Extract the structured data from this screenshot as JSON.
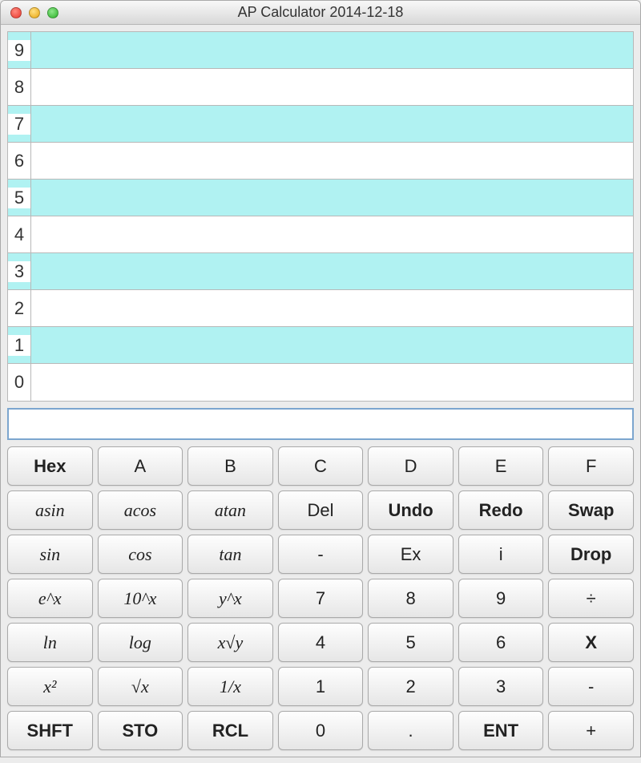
{
  "window": {
    "title": "AP Calculator 2014-12-18"
  },
  "stack": {
    "rows": [
      {
        "index": "9",
        "value": "",
        "alt": true
      },
      {
        "index": "8",
        "value": "",
        "alt": false
      },
      {
        "index": "7",
        "value": "",
        "alt": true
      },
      {
        "index": "6",
        "value": "",
        "alt": false
      },
      {
        "index": "5",
        "value": "",
        "alt": true
      },
      {
        "index": "4",
        "value": "",
        "alt": false
      },
      {
        "index": "3",
        "value": "",
        "alt": true
      },
      {
        "index": "2",
        "value": "",
        "alt": false
      },
      {
        "index": "1",
        "value": "",
        "alt": true
      },
      {
        "index": "0",
        "value": "",
        "alt": false
      }
    ]
  },
  "input": {
    "value": ""
  },
  "keypad": {
    "rows": [
      [
        {
          "label": "Hex",
          "style": "bold",
          "name": "hex-button"
        },
        {
          "label": "A",
          "style": "",
          "name": "hex-a-button"
        },
        {
          "label": "B",
          "style": "",
          "name": "hex-b-button"
        },
        {
          "label": "C",
          "style": "",
          "name": "hex-c-button"
        },
        {
          "label": "D",
          "style": "",
          "name": "hex-d-button"
        },
        {
          "label": "E",
          "style": "",
          "name": "hex-e-button"
        },
        {
          "label": "F",
          "style": "",
          "name": "hex-f-button"
        }
      ],
      [
        {
          "label": "asin",
          "style": "italic",
          "name": "asin-button"
        },
        {
          "label": "acos",
          "style": "italic",
          "name": "acos-button"
        },
        {
          "label": "atan",
          "style": "italic",
          "name": "atan-button"
        },
        {
          "label": "Del",
          "style": "",
          "name": "del-button"
        },
        {
          "label": "Undo",
          "style": "bold",
          "name": "undo-button"
        },
        {
          "label": "Redo",
          "style": "bold",
          "name": "redo-button"
        },
        {
          "label": "Swap",
          "style": "bold",
          "name": "swap-button"
        }
      ],
      [
        {
          "label": "sin",
          "style": "italic",
          "name": "sin-button"
        },
        {
          "label": "cos",
          "style": "italic",
          "name": "cos-button"
        },
        {
          "label": "tan",
          "style": "italic",
          "name": "tan-button"
        },
        {
          "label": "-",
          "style": "",
          "name": "negate-button"
        },
        {
          "label": "Ex",
          "style": "",
          "name": "ex-button"
        },
        {
          "label": "i",
          "style": "",
          "name": "imaginary-button"
        },
        {
          "label": "Drop",
          "style": "bold",
          "name": "drop-button"
        }
      ],
      [
        {
          "label": "e^x",
          "style": "italic",
          "name": "exp-button"
        },
        {
          "label": "10^x",
          "style": "italic",
          "name": "ten-power-button"
        },
        {
          "label": "y^x",
          "style": "italic",
          "name": "y-power-x-button"
        },
        {
          "label": "7",
          "style": "",
          "name": "digit-7-button"
        },
        {
          "label": "8",
          "style": "",
          "name": "digit-8-button"
        },
        {
          "label": "9",
          "style": "",
          "name": "digit-9-button"
        },
        {
          "label": "÷",
          "style": "",
          "name": "divide-button"
        }
      ],
      [
        {
          "label": "ln",
          "style": "italic",
          "name": "ln-button"
        },
        {
          "label": "log",
          "style": "italic",
          "name": "log-button"
        },
        {
          "label": "x√y",
          "style": "italic",
          "name": "x-root-y-button"
        },
        {
          "label": "4",
          "style": "",
          "name": "digit-4-button"
        },
        {
          "label": "5",
          "style": "",
          "name": "digit-5-button"
        },
        {
          "label": "6",
          "style": "",
          "name": "digit-6-button"
        },
        {
          "label": "X",
          "style": "bold",
          "name": "multiply-button"
        }
      ],
      [
        {
          "label": "x²",
          "style": "italic",
          "name": "square-button"
        },
        {
          "label": "√x",
          "style": "italic",
          "name": "sqrt-button"
        },
        {
          "label": "1/x",
          "style": "italic",
          "name": "reciprocal-button"
        },
        {
          "label": "1",
          "style": "",
          "name": "digit-1-button"
        },
        {
          "label": "2",
          "style": "",
          "name": "digit-2-button"
        },
        {
          "label": "3",
          "style": "",
          "name": "digit-3-button"
        },
        {
          "label": "-",
          "style": "",
          "name": "subtract-button"
        }
      ],
      [
        {
          "label": "SHFT",
          "style": "bold",
          "name": "shift-button"
        },
        {
          "label": "STO",
          "style": "bold",
          "name": "store-button"
        },
        {
          "label": "RCL",
          "style": "bold",
          "name": "recall-button"
        },
        {
          "label": "0",
          "style": "",
          "name": "digit-0-button"
        },
        {
          "label": ".",
          "style": "",
          "name": "decimal-button"
        },
        {
          "label": "ENT",
          "style": "bold",
          "name": "enter-button"
        },
        {
          "label": "+",
          "style": "",
          "name": "add-button"
        }
      ]
    ]
  }
}
